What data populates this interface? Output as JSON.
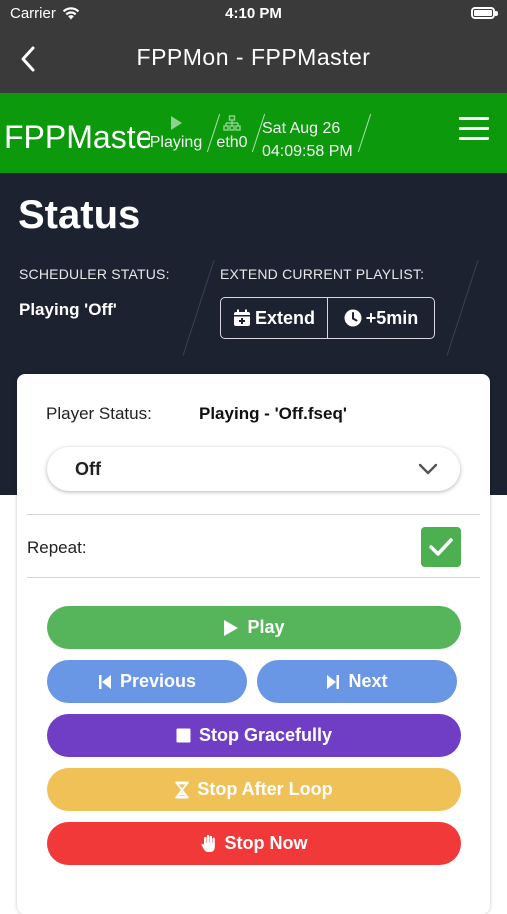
{
  "status_bar": {
    "carrier": "Carrier",
    "time": "4:10 PM"
  },
  "nav": {
    "title": "FPPMon - FPPMaster",
    "back_icon": "chevron-left-icon"
  },
  "header": {
    "brand": "FPPMaster",
    "player_state": "Playing",
    "interface": "eth0",
    "date": "Sat Aug 26",
    "time": "04:09:58 PM",
    "bg_color": "#0c9a0c"
  },
  "status_panel": {
    "title": "Status",
    "scheduler_label": "SCHEDULER STATUS:",
    "scheduler_value": "Playing 'Off'",
    "extend_label": "EXTEND CURRENT PLAYLIST:",
    "extend_button": "Extend",
    "plus_button": "+5min"
  },
  "player": {
    "status_label": "Player Status:",
    "status_value": "Playing - 'Off.fseq'",
    "playlist_selected": "Off",
    "repeat_label": "Repeat:",
    "repeat_checked": true
  },
  "controls": {
    "play": "Play",
    "previous": "Previous",
    "next": "Next",
    "stop_gracefully": "Stop Gracefully",
    "stop_after_loop": "Stop After Loop",
    "stop_now": "Stop Now"
  },
  "colors": {
    "play": "#56b55a",
    "nav_buttons": "#6a96e6",
    "stop_gracefully": "#6f3ec4",
    "stop_after_loop": "#f0c157",
    "stop_now": "#f1393a",
    "dark_panel": "#1d2230"
  }
}
